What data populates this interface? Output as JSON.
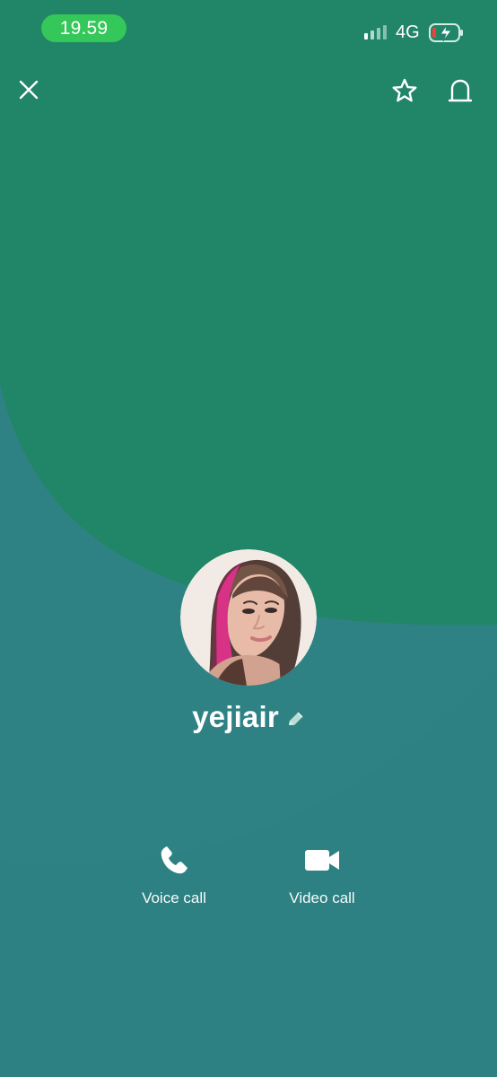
{
  "status_bar": {
    "time": "19.59",
    "network": "4G",
    "icons": {
      "signal": "signal-bars-icon",
      "battery": "battery-charging-icon"
    }
  },
  "header": {
    "icons": {
      "close": "close-icon",
      "favorite": "star-icon",
      "notify": "bell-icon"
    }
  },
  "profile": {
    "name": "yejiair",
    "avatar_icon": "profile-photo",
    "edit_icon": "pencil-icon"
  },
  "actions": {
    "voice_call": {
      "label": "Voice call",
      "icon": "phone-icon"
    },
    "video_call": {
      "label": "Video call",
      "icon": "video-camera-icon"
    }
  },
  "colors": {
    "background": "#2f8284",
    "top_shape": "#218567",
    "time_pill": "#34c759",
    "text": "#ffffff"
  }
}
